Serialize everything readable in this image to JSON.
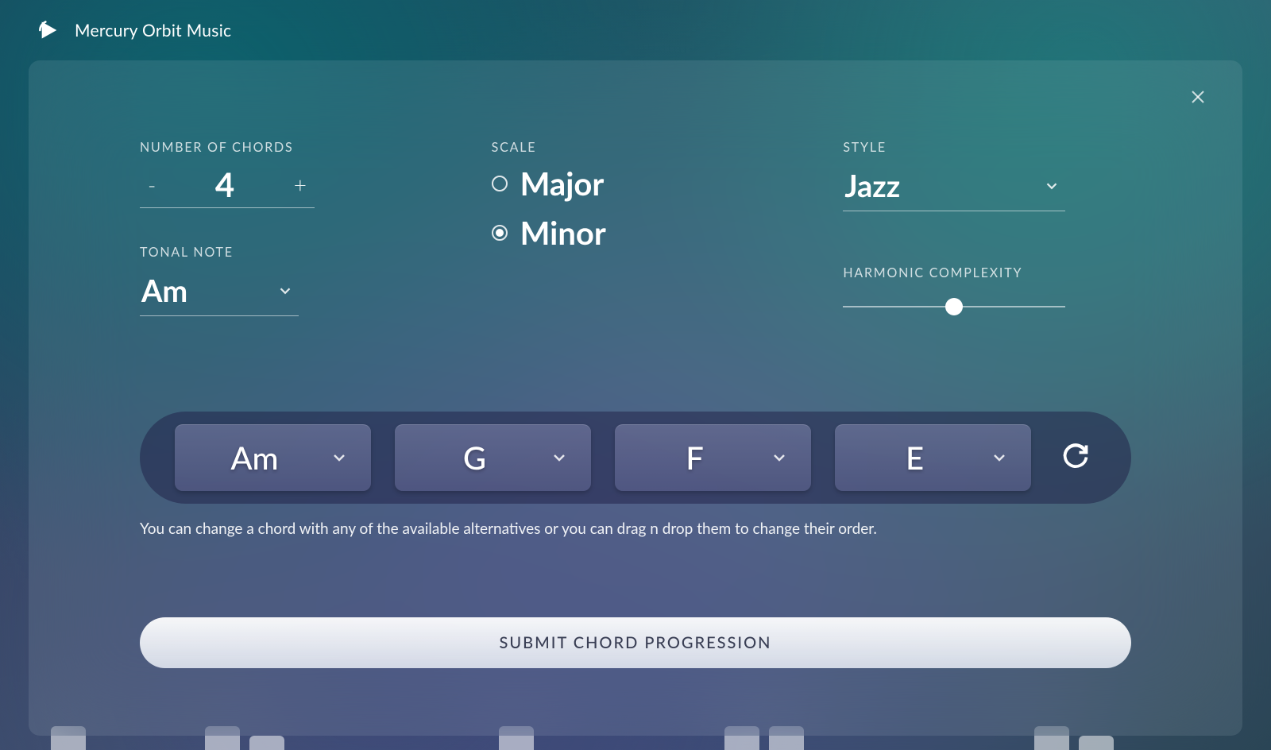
{
  "app": {
    "title": "Mercury Orbit Music"
  },
  "controls": {
    "number_of_chords": {
      "label": "NUMBER OF CHORDS",
      "value": "4"
    },
    "tonal_note": {
      "label": "TONAL NOTE",
      "value": "Am"
    },
    "scale": {
      "label": "SCALE",
      "options": {
        "major": "Major",
        "minor": "Minor"
      },
      "selected": "minor"
    },
    "style": {
      "label": "STYLE",
      "value": "Jazz"
    },
    "harmonic_complexity": {
      "label": "HARMONIC COMPLEXITY",
      "value_percent": 50
    }
  },
  "chords": [
    "Am",
    "G",
    "F",
    "E"
  ],
  "help_text": "You can change a chord with any of the available alternatives or you can drag n drop them to change their order.",
  "submit_label": "SUBMIT CHORD PROGRESSION"
}
